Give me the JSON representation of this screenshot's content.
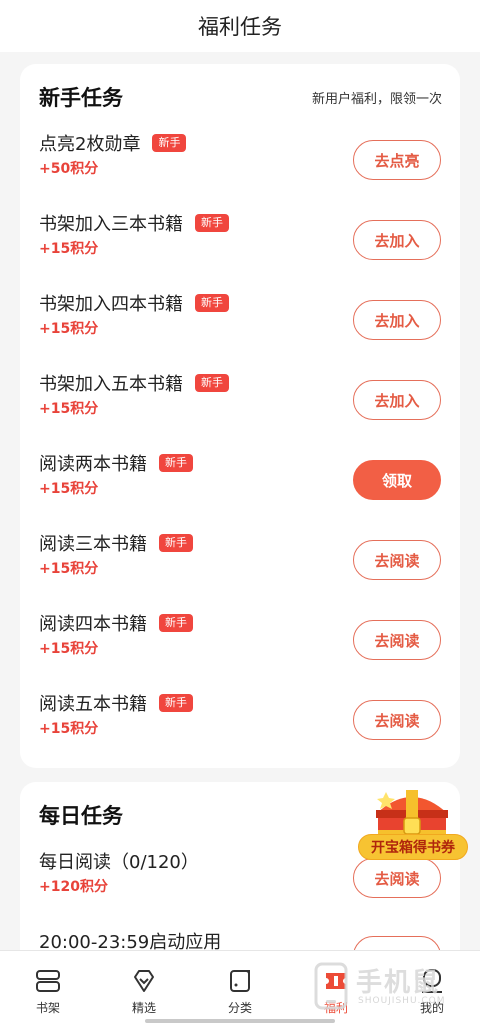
{
  "header": {
    "title": "福利任务"
  },
  "newbie": {
    "title": "新手任务",
    "subtitle": "新用户福利，限领一次",
    "tasks": [
      {
        "name": "点亮2枚勋章",
        "badge": "新手",
        "points": "+50积分",
        "action": "去点亮"
      },
      {
        "name": "书架加入三本书籍",
        "badge": "新手",
        "points": "+15积分",
        "action": "去加入"
      },
      {
        "name": "书架加入四本书籍",
        "badge": "新手",
        "points": "+15积分",
        "action": "去加入"
      },
      {
        "name": "书架加入五本书籍",
        "badge": "新手",
        "points": "+15积分",
        "action": "去加入"
      },
      {
        "name": "阅读两本书籍",
        "badge": "新手",
        "points": "+15积分",
        "action": "领取"
      },
      {
        "name": "阅读三本书籍",
        "badge": "新手",
        "points": "+15积分",
        "action": "去阅读"
      },
      {
        "name": "阅读四本书籍",
        "badge": "新手",
        "points": "+15积分",
        "action": "去阅读"
      },
      {
        "name": "阅读五本书籍",
        "badge": "新手",
        "points": "+15积分",
        "action": "去阅读"
      }
    ]
  },
  "daily": {
    "title": "每日任务",
    "tasks": [
      {
        "name": "每日阅读（0/120）",
        "points": "+120积分",
        "action": "去阅读"
      },
      {
        "name": "20:00-23:59启动应用",
        "points": "",
        "action": ""
      }
    ]
  },
  "chest": {
    "label": "开宝箱得书券"
  },
  "tabbar": {
    "items": [
      {
        "label": "书架",
        "icon": "bookshelf-icon"
      },
      {
        "label": "精选",
        "icon": "diamond-icon"
      },
      {
        "label": "分类",
        "icon": "category-icon"
      },
      {
        "label": "福利",
        "icon": "ticket-icon",
        "active": true
      },
      {
        "label": "我的",
        "icon": "profile-icon"
      }
    ]
  },
  "watermark": {
    "main": "手机鼠",
    "sub": "SHOUJISHU.COM"
  },
  "colors": {
    "accent": "#f25f45",
    "points": "#e8433a",
    "badge": "#f0463e"
  }
}
